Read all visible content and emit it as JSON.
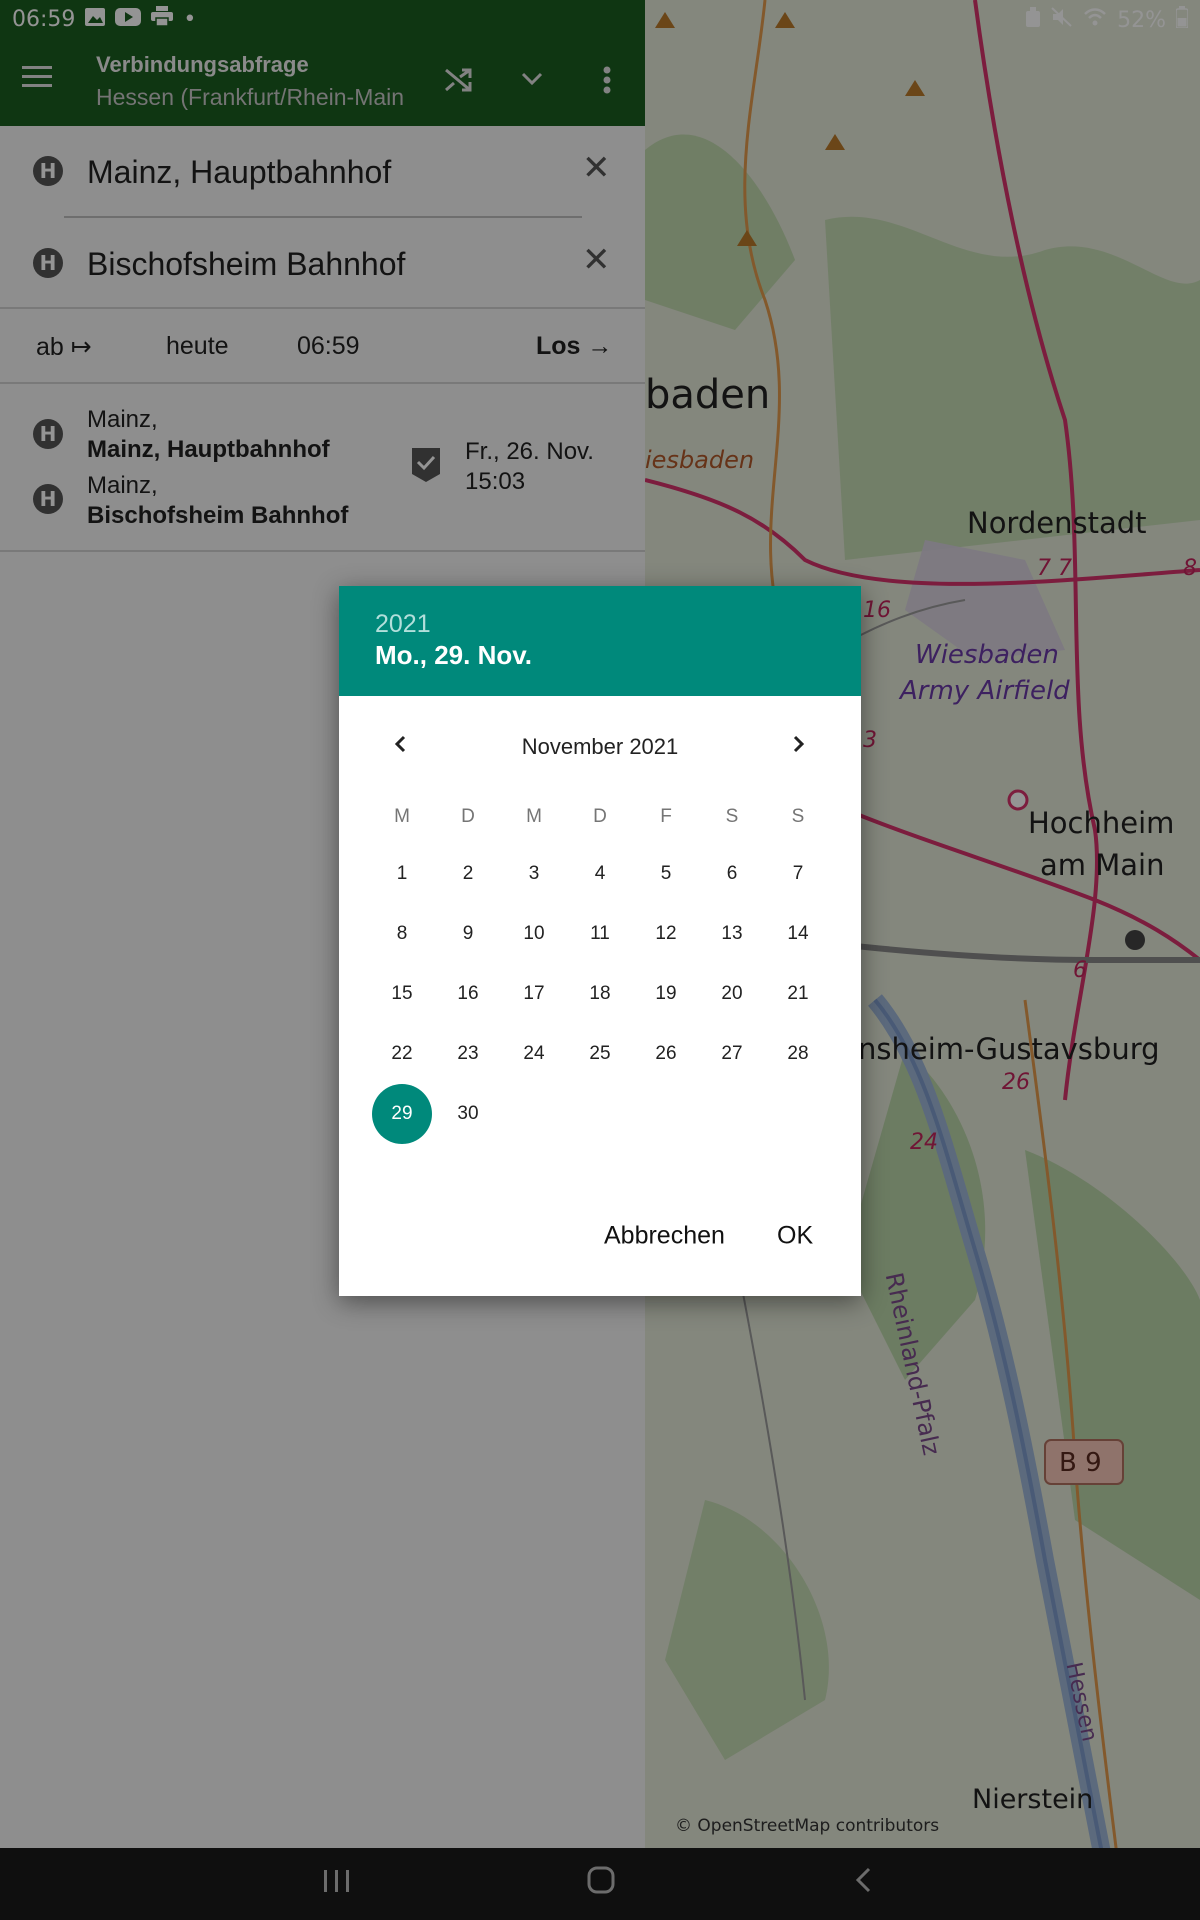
{
  "status_bar": {
    "time": "06:59",
    "battery": "52%",
    "dot": "•"
  },
  "toolbar": {
    "title": "Verbindungsabfrage",
    "subtitle": "Hessen (Frankfurt/Rhein-Main",
    "menu_icon": "hamburger-menu-icon",
    "shuffle_icon": "shuffle-icon",
    "dropdown_icon": "chevron-down-icon",
    "more_icon": "more-vert-icon",
    "bar_color": "#1b5e20"
  },
  "search": {
    "from": "Mainz, Hauptbahnhof",
    "to": "Bischofsheim Bahnhof",
    "stop_badge": "H"
  },
  "options": {
    "departure": "ab ↦",
    "day": "heute",
    "time": "06:59",
    "go": "Los →"
  },
  "history": {
    "from_city": "Mainz,",
    "from_name": "Mainz, Hauptbahnhof",
    "to_city": "Mainz,",
    "to_name": "Bischofsheim Bahnhof",
    "date": "Fr., 26. Nov.",
    "time": "15:03"
  },
  "map": {
    "labels": {
      "wiesbaden_part": "baden",
      "wiesbaden_italic": "iesbaden",
      "nordenstadt": "Nordenstadt",
      "road_77": "7 7",
      "road_8": "8",
      "road_16": "16",
      "road_3": "3",
      "airfield_1": "Wiesbaden",
      "airfield_2": "Army Airfield",
      "hochheim_1": "Hochheim",
      "hochheim_2": "am Main",
      "road_6": "6",
      "gustavsburg": "nsheim-Gustavsburg",
      "road_26": "26",
      "road_24": "24",
      "rheinland": "Rheinland-Pfalz",
      "b9": "B 9",
      "hessen": "Hessen",
      "nierstein": "Nierstein",
      "attribution": "© OpenStreetMap contributors"
    }
  },
  "date_picker": {
    "year": "2021",
    "selected_date": "Mo., 29. Nov.",
    "month": "November 2021",
    "weekdays": [
      "M",
      "D",
      "M",
      "D",
      "F",
      "S",
      "S"
    ],
    "days": [
      "1",
      "2",
      "3",
      "4",
      "5",
      "6",
      "7",
      "8",
      "9",
      "10",
      "11",
      "12",
      "13",
      "14",
      "15",
      "16",
      "17",
      "18",
      "19",
      "20",
      "21",
      "22",
      "23",
      "24",
      "25",
      "26",
      "27",
      "28",
      "29",
      "30"
    ],
    "selected_day": "29",
    "cancel_label": "Abbrechen",
    "ok_label": "OK",
    "accent_color": "#00897b"
  }
}
